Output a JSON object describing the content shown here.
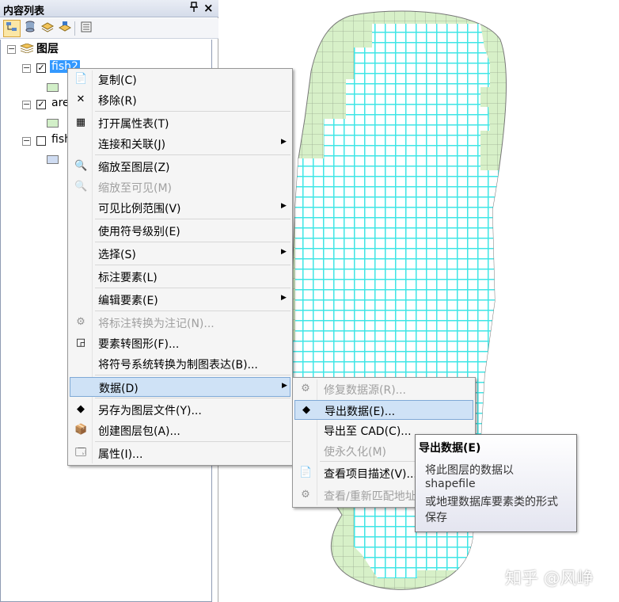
{
  "toc": {
    "title": "内容列表",
    "pin_glyph": "p",
    "close_glyph": "×",
    "toolbar": [
      "list-by-drawing-order",
      "list-by-source",
      "list-by-visibility",
      "list-by-selection",
      "options"
    ],
    "root_label": "图层",
    "layers": [
      {
        "label": "fish2",
        "checked": true,
        "selected": true,
        "swatch": "#d2efc8"
      },
      {
        "label": "are",
        "checked": true,
        "selected": false,
        "swatch": "#d2efc8"
      },
      {
        "label": "fish",
        "checked": false,
        "selected": false,
        "swatch": "#cfdcf2"
      }
    ]
  },
  "context_menu": {
    "items": [
      {
        "label": "复制(C)",
        "icon": "copy-icon",
        "glyph": "📄",
        "disabled": false,
        "submenu": false
      },
      {
        "label": "移除(R)",
        "icon": "remove-icon",
        "glyph": "✕",
        "disabled": false,
        "submenu": false
      },
      {
        "label": "打开属性表(T)",
        "icon": "table-icon",
        "glyph": "▦",
        "disabled": false,
        "submenu": false
      },
      {
        "label": "连接和关联(J)",
        "icon": "",
        "glyph": "",
        "disabled": false,
        "submenu": true
      },
      {
        "label": "缩放至图层(Z)",
        "icon": "zoom-layer-icon",
        "glyph": "🔍",
        "disabled": false,
        "submenu": false
      },
      {
        "label": "缩放至可见(M)",
        "icon": "zoom-visible-icon",
        "glyph": "🔍",
        "disabled": true,
        "submenu": false
      },
      {
        "label": "可见比例范围(V)",
        "icon": "",
        "glyph": "",
        "disabled": false,
        "submenu": true
      },
      {
        "label": "使用符号级别(E)",
        "icon": "",
        "glyph": "",
        "disabled": false,
        "submenu": false
      },
      {
        "label": "选择(S)",
        "icon": "",
        "glyph": "",
        "disabled": false,
        "submenu": true
      },
      {
        "label": "标注要素(L)",
        "icon": "",
        "glyph": "",
        "disabled": false,
        "submenu": false
      },
      {
        "label": "编辑要素(E)",
        "icon": "",
        "glyph": "",
        "disabled": false,
        "submenu": true
      },
      {
        "label": "将标注转换为注记(N)...",
        "icon": "convert-labels-icon",
        "glyph": "⚙",
        "disabled": true,
        "submenu": false
      },
      {
        "label": "要素转图形(F)...",
        "icon": "features-to-graphics-icon",
        "glyph": "◲",
        "disabled": false,
        "submenu": false
      },
      {
        "label": "将符号系统转换为制图表达(B)...",
        "icon": "",
        "glyph": "",
        "disabled": false,
        "submenu": false
      },
      {
        "label": "数据(D)",
        "icon": "",
        "glyph": "",
        "disabled": false,
        "submenu": true,
        "highlighted": true
      },
      {
        "label": "另存为图层文件(Y)...",
        "icon": "layer-file-icon",
        "glyph": "◆",
        "disabled": false,
        "submenu": false
      },
      {
        "label": "创建图层包(A)...",
        "icon": "layer-package-icon",
        "glyph": "📦",
        "disabled": false,
        "submenu": false
      },
      {
        "label": "属性(I)...",
        "icon": "properties-icon",
        "glyph": "🗔",
        "disabled": false,
        "submenu": false
      }
    ],
    "arrow_glyph": "▶"
  },
  "submenu": {
    "items": [
      {
        "label": "修复数据源(R)...",
        "icon": "repair-source-icon",
        "glyph": "⚙",
        "disabled": true
      },
      {
        "label": "导出数据(E)...",
        "icon": "export-data-icon",
        "glyph": "◆",
        "disabled": false,
        "highlighted": true
      },
      {
        "label": "导出至 CAD(C)...",
        "icon": "",
        "glyph": "",
        "disabled": false
      },
      {
        "label": "使永久化(M)",
        "icon": "",
        "glyph": "",
        "disabled": true
      },
      {
        "label": "查看项目描述(V)...",
        "icon": "item-description-icon",
        "glyph": "📄",
        "disabled": false
      },
      {
        "label": "查看/重新匹配地址",
        "icon": "rematch-address-icon",
        "glyph": "⚙",
        "disabled": true
      }
    ]
  },
  "tooltip": {
    "title": "导出数据(E)",
    "lines": [
      "将此图层的数据以",
      "shapefile",
      "或地理数据库要素类的形式",
      "保存"
    ]
  },
  "watermark": "知乎 @风峥",
  "colors": {
    "grid_fill": "#ffffff",
    "grid_line": "#3fe6e6",
    "area_fill": "#d7f0c8",
    "area_grid": "#9aaa90",
    "menu_highlight": "#cfe2f6"
  }
}
